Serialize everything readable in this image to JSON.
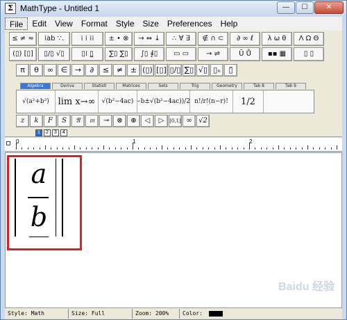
{
  "window": {
    "title": "MathType - Untitled 1",
    "app_icon_letter": "Σ"
  },
  "window_controls": {
    "minimize": "—",
    "maximize": "☐",
    "close": "✕"
  },
  "menu": [
    "File",
    "Edit",
    "View",
    "Format",
    "Style",
    "Size",
    "Preferences",
    "Help"
  ],
  "symbol_row_1": [
    "≤ ≠ ≈",
    "⁞ab ∵.",
    "⁞ ⁞ ⁞⁞",
    "± • ⊗",
    "→ ⇔ ↓",
    "∴ ∀ ∃",
    "∉ ∩ ⊂",
    "∂ ∞ ℓ",
    "λ ω θ",
    "Λ Ω Θ"
  ],
  "symbol_row_2": [
    "(▯) [▯]",
    "▯/▯ √▯",
    "▯⁞ ▯̲",
    "∑▯ ∑▯",
    "∫▯ ∮▯",
    "▭ ▭",
    "→ ⇌",
    "Ū Ů",
    "▪▪ ▦",
    "▯ ▯"
  ],
  "symbol_row_3": [
    "π",
    "θ",
    "∞",
    "∈",
    "→",
    "∂",
    "≤",
    "≠",
    "±",
    "(▯)",
    "[▯]",
    "▯/▯",
    "∑▯",
    "√▯",
    "▯ₙ",
    "▯̈"
  ],
  "tabs": [
    "Algebra",
    "Deriva",
    "Statisti",
    "Matrices",
    "Sets",
    "Trig",
    "Geometry",
    "Tab 8",
    "Tab 9"
  ],
  "templates": [
    "√(a²+b²)",
    "lim x→∞",
    "√(b²−4ac)",
    "(−b±√(b²−4ac))/2a",
    "n!/r!(n−r)!",
    "1/2"
  ],
  "small_row": [
    "z",
    "k",
    "F",
    "S",
    "𝔄",
    "𝔪",
    "⊸",
    "⊗",
    "⊕",
    "◁",
    "▷",
    "[0,1]",
    "∞",
    "√2"
  ],
  "size_tabs": [
    "1",
    "2",
    "3",
    "4"
  ],
  "ruler": {
    "labels": [
      "0",
      "1",
      "2"
    ]
  },
  "equation": {
    "numerator": "a",
    "denominator": "b"
  },
  "status": {
    "style": "Style: Math",
    "size": "Size: Full",
    "zoom": "Zoom: 200%",
    "color_label": "Color:",
    "color": "#000000"
  },
  "watermark": "Baidu 经验"
}
